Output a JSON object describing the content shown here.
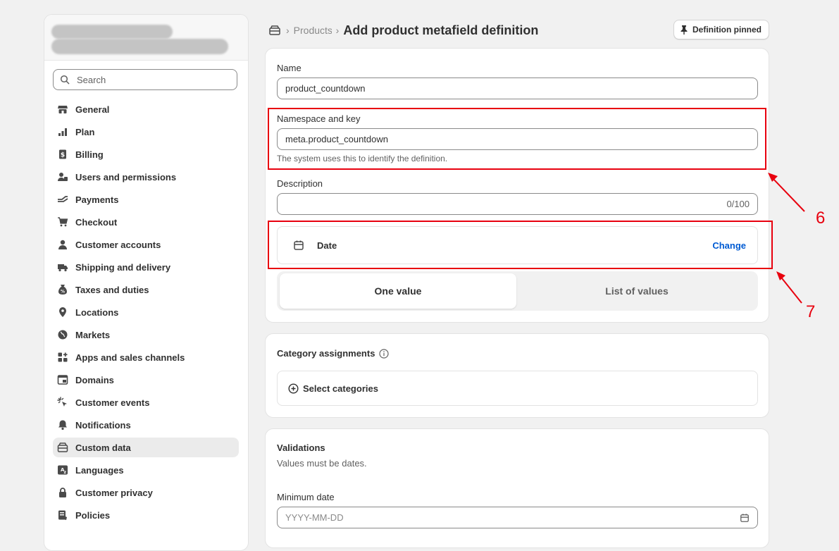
{
  "sidebar": {
    "search_placeholder": "Search",
    "items": [
      {
        "label": "General",
        "icon": "store-icon"
      },
      {
        "label": "Plan",
        "icon": "plan-icon"
      },
      {
        "label": "Billing",
        "icon": "billing-icon"
      },
      {
        "label": "Users and permissions",
        "icon": "users-icon"
      },
      {
        "label": "Payments",
        "icon": "payments-icon"
      },
      {
        "label": "Checkout",
        "icon": "cart-icon"
      },
      {
        "label": "Customer accounts",
        "icon": "person-icon"
      },
      {
        "label": "Shipping and delivery",
        "icon": "truck-icon"
      },
      {
        "label": "Taxes and duties",
        "icon": "tax-icon"
      },
      {
        "label": "Locations",
        "icon": "location-pin-icon"
      },
      {
        "label": "Markets",
        "icon": "globe-icon"
      },
      {
        "label": "Apps and sales channels",
        "icon": "apps-icon"
      },
      {
        "label": "Domains",
        "icon": "domains-icon"
      },
      {
        "label": "Customer events",
        "icon": "cursor-click-icon"
      },
      {
        "label": "Notifications",
        "icon": "bell-icon"
      },
      {
        "label": "Custom data",
        "icon": "custom-data-icon",
        "active": true
      },
      {
        "label": "Languages",
        "icon": "translate-icon"
      },
      {
        "label": "Customer privacy",
        "icon": "lock-icon"
      },
      {
        "label": "Policies",
        "icon": "policy-icon"
      }
    ]
  },
  "header": {
    "breadcrumb_link": "Products",
    "title": "Add product metafield definition",
    "pin_button": "Definition pinned"
  },
  "definition": {
    "name_label": "Name",
    "name_value": "product_countdown",
    "namespace_label": "Namespace and key",
    "namespace_value": "meta.product_countdown",
    "namespace_help": "The system uses this to identify the definition.",
    "description_label": "Description",
    "description_counter": "0/100",
    "type_name": "Date",
    "change_label": "Change",
    "one_value": "One value",
    "list_values": "List of values"
  },
  "category": {
    "title": "Category assignments",
    "select_label": "Select categories"
  },
  "validations": {
    "title": "Validations",
    "subtitle": "Values must be dates.",
    "min_label": "Minimum date",
    "min_placeholder": "YYYY-MM-DD"
  },
  "annotations": {
    "box6": "6",
    "box7": "7"
  },
  "colors": {
    "accent": "#e8000e",
    "link": "#005bd3"
  }
}
